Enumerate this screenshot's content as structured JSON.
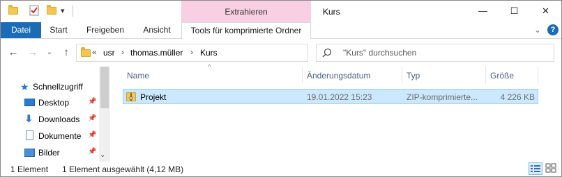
{
  "title_bar": {
    "context_tab_header": "Extrahieren",
    "window_title": "Kurs",
    "minimize": "—",
    "maximize": "☐",
    "close": "✕",
    "qa_dropdown": "▾"
  },
  "ribbon": {
    "tabs": [
      "Datei",
      "Start",
      "Freigeben",
      "Ansicht",
      "Tools für komprimierte Ordner"
    ],
    "expand_glyph": "⌄",
    "help": "?"
  },
  "address": {
    "overflow": "«",
    "crumbs": [
      "usr",
      "thomas.müller",
      "Kurs"
    ],
    "separator": "›",
    "dropdown": "⌄",
    "refresh": "↻"
  },
  "search": {
    "placeholder": "\"Kurs\" durchsuchen"
  },
  "nav_pane": {
    "items": [
      {
        "label": "Schnellzugriff",
        "icon": "star-icon"
      },
      {
        "label": "Desktop",
        "icon": "desktop-icon",
        "pinned": true
      },
      {
        "label": "Downloads",
        "icon": "download-arrow-icon",
        "pinned": true
      },
      {
        "label": "Dokumente",
        "icon": "document-icon",
        "pinned": true
      },
      {
        "label": "Bilder",
        "icon": "pictures-icon",
        "pinned": true
      }
    ],
    "pin_glyph": "📌"
  },
  "file_list": {
    "sort_indicator": "^",
    "columns": [
      "Name",
      "Änderungsdatum",
      "Typ",
      "Größe"
    ],
    "rows": [
      {
        "name": "Projekt",
        "modified": "19.01.2022 15:23",
        "type": "ZIP-komprimierte...",
        "size": "4 226 KB",
        "selected": true
      }
    ]
  },
  "status_bar": {
    "count": "1 Element",
    "selection": "1 Element ausgewählt (4,12 MB)"
  },
  "colors": {
    "accent": "#1a6cb6",
    "context_tab": "#f8cfe3",
    "selection_fill": "#cce8ff",
    "selection_border": "#99d1ff",
    "folder": "#f3c851"
  }
}
